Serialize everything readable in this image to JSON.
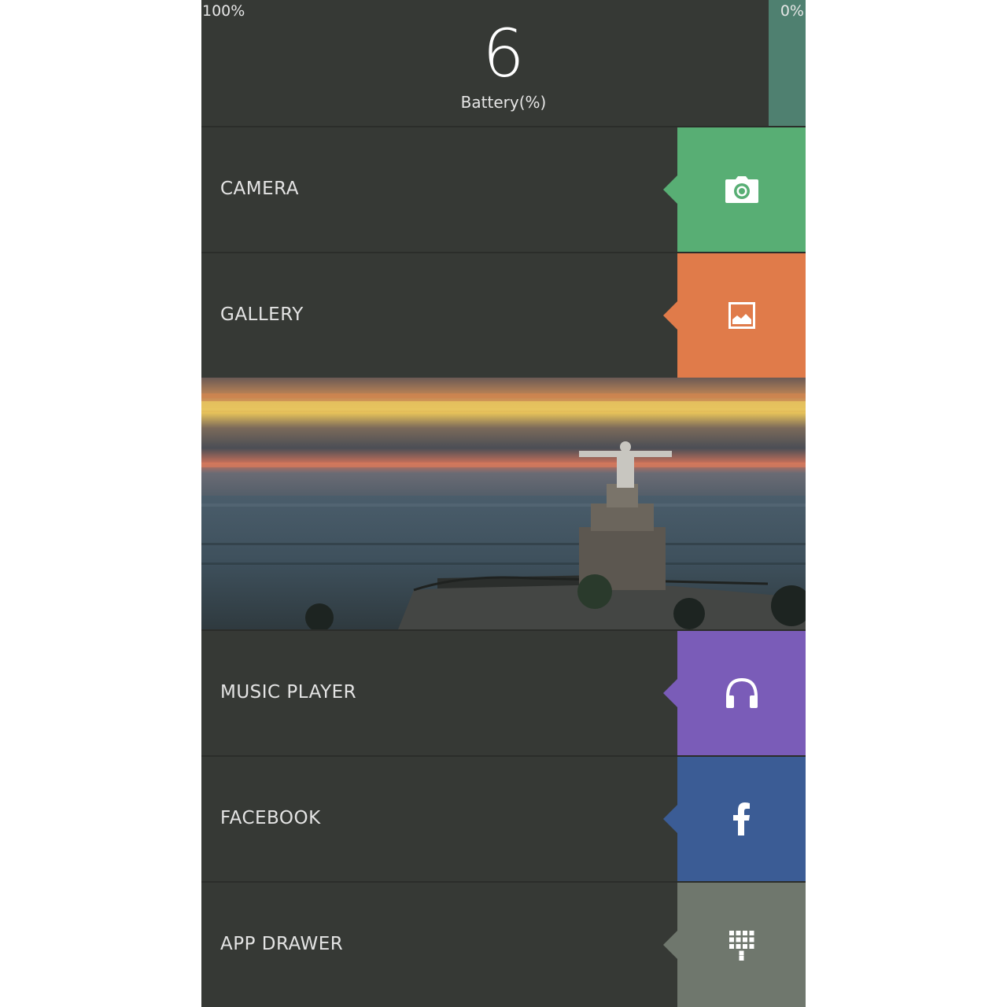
{
  "battery": {
    "max_label": "100%",
    "min_label": "0%",
    "value": "6",
    "label": "Battery(%)",
    "level_percent": 6,
    "gauge_color": "#4f8070"
  },
  "tiles": [
    {
      "label": "CAMERA",
      "icon": "camera-icon",
      "color": "#58ae74"
    },
    {
      "label": "GALLERY",
      "icon": "image-icon",
      "color": "#e07b4a"
    },
    {
      "label": "MUSIC PLAYER",
      "icon": "headphones-icon",
      "color": "#7a5cb8"
    },
    {
      "label": "FACEBOOK",
      "icon": "facebook-icon",
      "color": "#3b5c95"
    },
    {
      "label": "APP DRAWER",
      "icon": "grid-icon",
      "color": "#6f776d"
    }
  ],
  "wallpaper": {
    "subject": "statue on hilltop at sunset"
  }
}
